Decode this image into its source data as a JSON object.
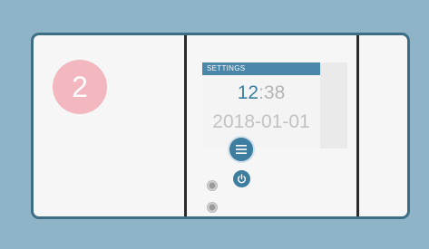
{
  "step": {
    "number": "2"
  },
  "screen": {
    "title": "SETTINGS",
    "time_hours": "12",
    "time_separator": ":",
    "time_minutes": "38",
    "date": "2018-01-01"
  },
  "icons": {
    "menu": "menu-icon",
    "power": "power-icon"
  },
  "colors": {
    "accent": "#3d7da0",
    "badge": "#f2b7bf",
    "frame": "#3d6e85",
    "background": "#8fb3c7"
  }
}
